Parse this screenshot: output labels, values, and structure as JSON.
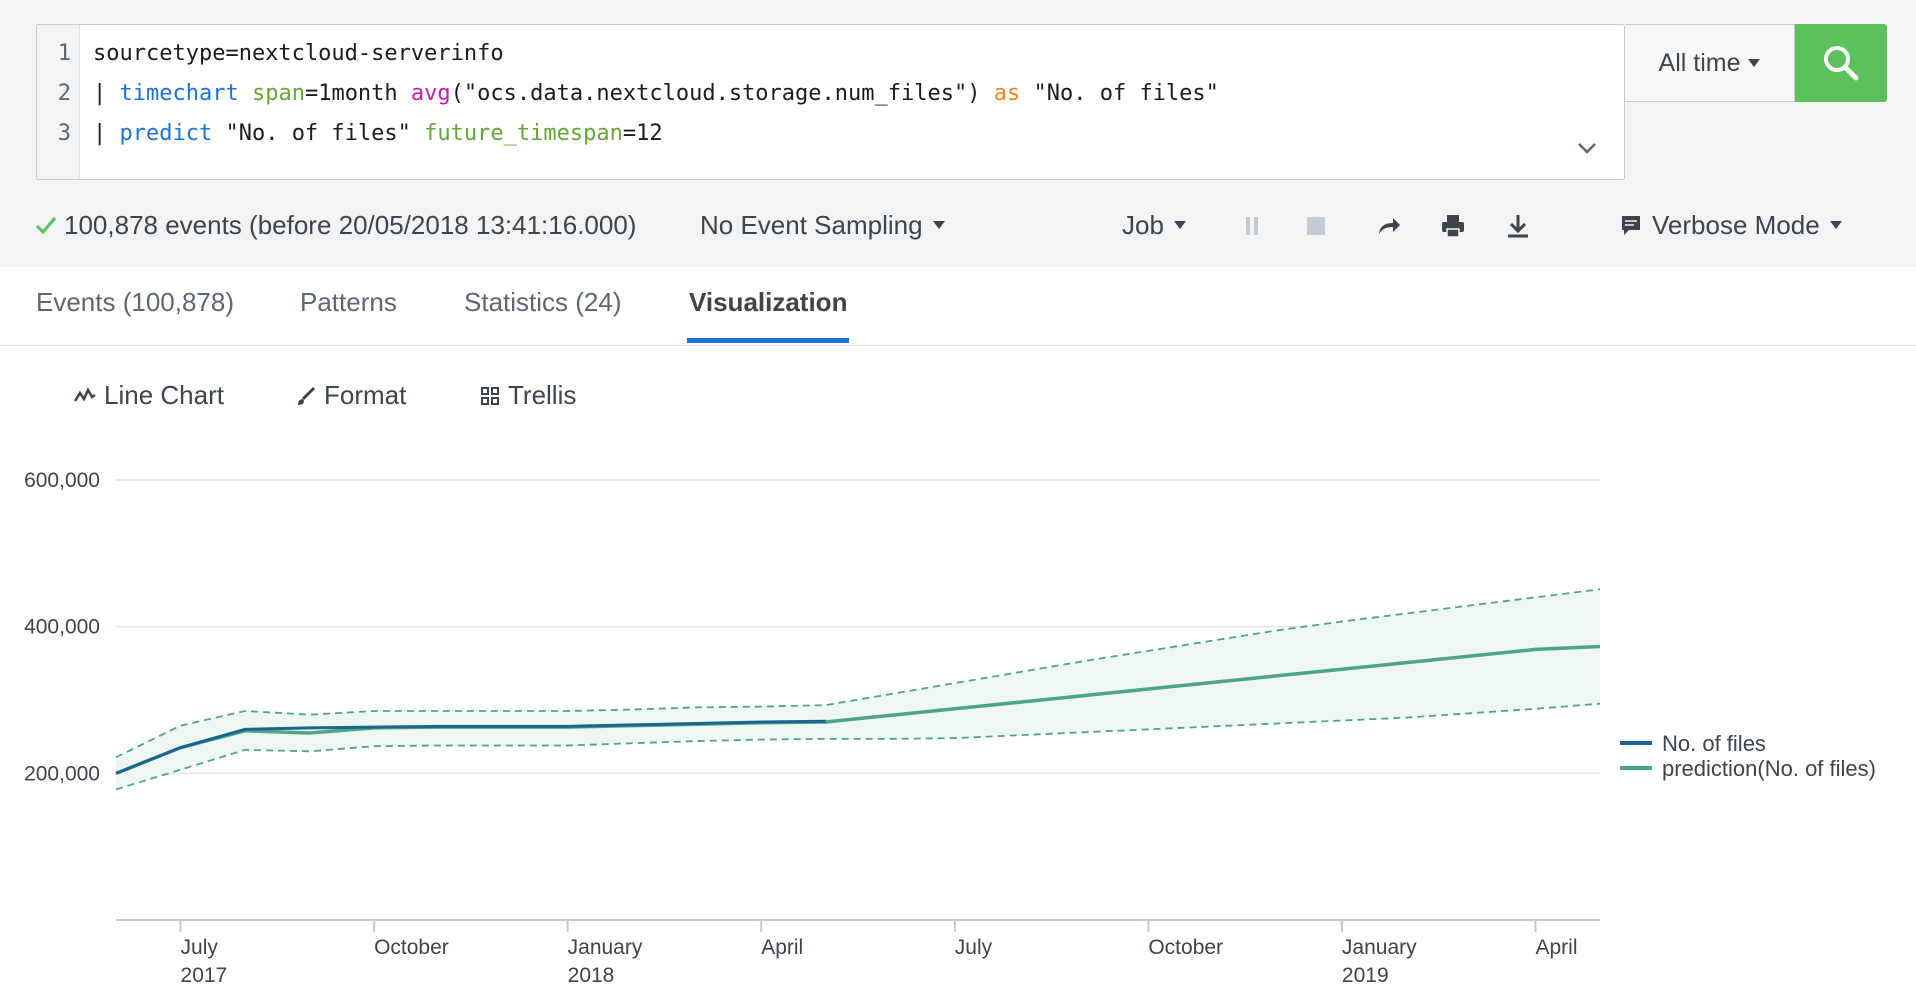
{
  "search": {
    "line_numbers": [
      "1",
      "2",
      "3"
    ],
    "line1": "sourcetype=nextcloud-serverinfo",
    "line2": {
      "pipe": "| ",
      "cmd": "timechart",
      "sp1": " ",
      "arg": "span",
      "val": "=1month ",
      "fn": "avg",
      "field": "(\"ocs.data.nextcloud.storage.num_files\") ",
      "kw": "as",
      "alias": " \"No. of files\""
    },
    "line3": {
      "pipe": "| ",
      "cmd": "predict",
      "field": " \"No. of files\" ",
      "arg": "future_timespan",
      "val": "=12"
    },
    "time_range": "All time"
  },
  "status": {
    "events_summary": "100,878 events (before 20/05/2018 13:41:16.000)",
    "sampling": "No Event Sampling",
    "job": "Job",
    "mode": "Verbose Mode"
  },
  "tabs": [
    {
      "label": "Events (100,878)"
    },
    {
      "label": "Patterns"
    },
    {
      "label": "Statistics (24)"
    },
    {
      "label": "Visualization"
    }
  ],
  "viz_controls": {
    "chart_type": "Line Chart",
    "format": "Format",
    "trellis": "Trellis"
  },
  "colors": {
    "actual": "#1a6394",
    "prediction": "#4da584",
    "band_fill": "#eef7f3",
    "accent": "#1e73d7",
    "search_green": "#5cc05c"
  },
  "chart_data": {
    "type": "line",
    "x": [
      "2017-06",
      "2017-07",
      "2017-08",
      "2017-09",
      "2017-10",
      "2017-11",
      "2017-12",
      "2018-01",
      "2018-02",
      "2018-03",
      "2018-04",
      "2018-05",
      "2018-06",
      "2018-07",
      "2018-08",
      "2018-09",
      "2018-10",
      "2018-11",
      "2018-12",
      "2019-01",
      "2019-02",
      "2019-03",
      "2019-04",
      "2019-05"
    ],
    "series": [
      {
        "name": "No. of files",
        "values": [
          200000,
          235000,
          260000,
          262000,
          263000,
          264000,
          264000,
          264000,
          266000,
          268000,
          270000,
          271000,
          null,
          null,
          null,
          null,
          null,
          null,
          null,
          null,
          null,
          null,
          null,
          null
        ]
      },
      {
        "name": "prediction(No. of files)",
        "values": [
          200000,
          235000,
          258000,
          255000,
          262000,
          263000,
          263000,
          263000,
          265000,
          267000,
          269000,
          270000,
          279000,
          288000,
          297000,
          306000,
          315000,
          324000,
          333000,
          342000,
          351000,
          360000,
          369000,
          373000
        ]
      }
    ],
    "band": {
      "upper": [
        222000,
        265000,
        285000,
        280000,
        285000,
        285000,
        285000,
        285000,
        287000,
        290000,
        291000,
        293000,
        308000,
        323000,
        338000,
        353000,
        367000,
        381000,
        395000,
        407000,
        418000,
        429000,
        440000,
        451000
      ],
      "lower": [
        178000,
        205000,
        232000,
        230000,
        237000,
        238000,
        238000,
        238000,
        241000,
        244000,
        246000,
        247000,
        247000,
        248000,
        252000,
        256000,
        260000,
        264000,
        268000,
        272000,
        276000,
        282000,
        288000,
        295000
      ]
    },
    "y_ticks": [
      "200,000",
      "400,000",
      "600,000"
    ],
    "x_ticks": [
      {
        "line1": "July",
        "line2": "2017"
      },
      {
        "line1": "October",
        "line2": ""
      },
      {
        "line1": "January",
        "line2": "2018"
      },
      {
        "line1": "April",
        "line2": ""
      },
      {
        "line1": "July",
        "line2": ""
      },
      {
        "line1": "October",
        "line2": ""
      },
      {
        "line1": "January",
        "line2": "2019"
      },
      {
        "line1": "April",
        "line2": ""
      }
    ],
    "ylim": [
      0,
      600000
    ],
    "grid": true,
    "legend_position": "right"
  }
}
